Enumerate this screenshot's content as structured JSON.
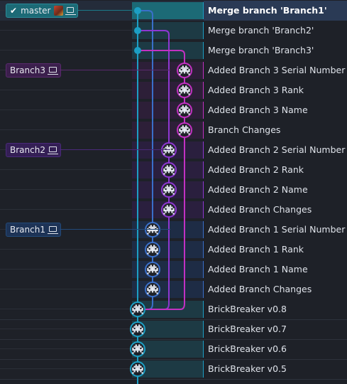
{
  "colors": {
    "blue": "#1c9fc4",
    "purple_light": "#c231c2",
    "purple_dark": "#8e37d1",
    "navy": "#3a6fc9",
    "bg": "#1e2128",
    "selected_row": "#2a3a55"
  },
  "branches": [
    {
      "label": "master",
      "row": 0,
      "checked": true,
      "has_avatar": true,
      "color": "#1b7a8a",
      "bg": "#1c5a65"
    },
    {
      "label": "Branch3",
      "row": 3,
      "checked": false,
      "has_avatar": false,
      "color": "#5a2a6e",
      "bg": "#3b1f4c"
    },
    {
      "label": "Branch2",
      "row": 7,
      "checked": false,
      "has_avatar": false,
      "color": "#4a2a7a",
      "bg": "#341f55"
    },
    {
      "label": "Branch1",
      "row": 11,
      "checked": false,
      "has_avatar": false,
      "color": "#234a7a",
      "bg": "#1d3356"
    }
  ],
  "commits": [
    {
      "message": "Merge branch 'Branch1'",
      "selected": true,
      "lane": 0,
      "kind": "merge"
    },
    {
      "message": "Merge branch 'Branch2'",
      "selected": false,
      "lane": 0,
      "kind": "merge"
    },
    {
      "message": "Merge branch 'Branch3'",
      "selected": false,
      "lane": 0,
      "kind": "merge"
    },
    {
      "message": "Added Branch 3 Serial Number",
      "selected": false,
      "lane": 3,
      "kind": "avatar"
    },
    {
      "message": "Added Branch 3 Rank",
      "selected": false,
      "lane": 3,
      "kind": "avatar"
    },
    {
      "message": "Added Branch 3 Name",
      "selected": false,
      "lane": 3,
      "kind": "avatar"
    },
    {
      "message": "Branch Changes",
      "selected": false,
      "lane": 3,
      "kind": "avatar"
    },
    {
      "message": "Added Branch 2 Serial Number",
      "selected": false,
      "lane": 2,
      "kind": "avatar"
    },
    {
      "message": "Added Branch 2 Rank",
      "selected": false,
      "lane": 2,
      "kind": "avatar"
    },
    {
      "message": "Added Branch 2 Name",
      "selected": false,
      "lane": 2,
      "kind": "avatar"
    },
    {
      "message": "Added Branch Changes",
      "selected": false,
      "lane": 2,
      "kind": "avatar"
    },
    {
      "message": "Added Branch 1 Serial Number",
      "selected": false,
      "lane": 1,
      "kind": "avatar"
    },
    {
      "message": "Added Branch 1 Rank",
      "selected": false,
      "lane": 1,
      "kind": "avatar"
    },
    {
      "message": "Added Branch 1 Name",
      "selected": false,
      "lane": 1,
      "kind": "avatar"
    },
    {
      "message": "Added Branch Changes",
      "selected": false,
      "lane": 1,
      "kind": "avatar"
    },
    {
      "message": "BrickBreaker v0.8",
      "selected": false,
      "lane": 0,
      "kind": "avatar"
    },
    {
      "message": "BrickBreaker v0.7",
      "selected": false,
      "lane": 0,
      "kind": "avatar"
    },
    {
      "message": "BrickBreaker v0.6",
      "selected": false,
      "lane": 0,
      "kind": "avatar"
    },
    {
      "message": "BrickBreaker v0.5",
      "selected": false,
      "lane": 0,
      "kind": "avatar"
    }
  ]
}
